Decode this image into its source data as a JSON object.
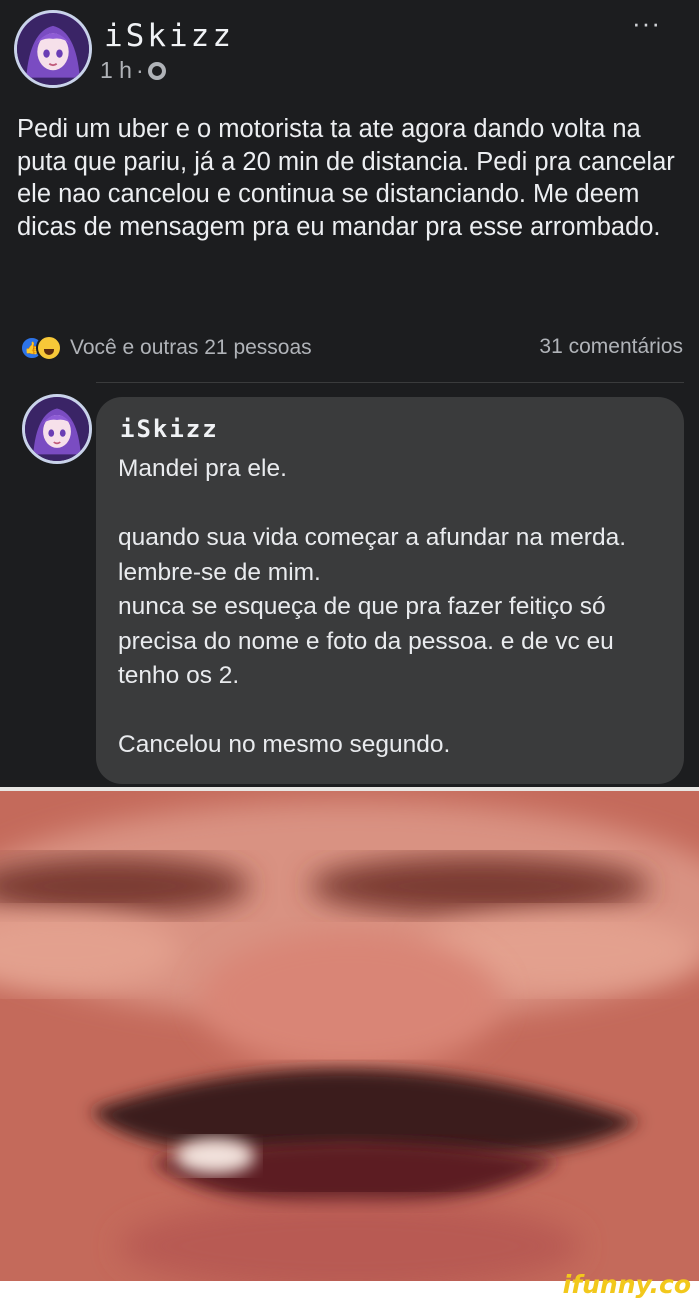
{
  "post": {
    "author": "iSkizz",
    "time": "1 h",
    "separator": "·",
    "more_label": "···",
    "text": "Pedi um uber e o motorista ta ate agora dando volta na puta que pariu, já a 20 min de distancia. Pedi pra cancelar ele nao cancelou e continua se distanciando. Me deem dicas de mensagem pra eu mandar pra esse arrombado.",
    "reactions_text": "Você e outras 21 pessoas",
    "comments_text": "31 comentários",
    "like_icon": "like-icon",
    "haha_icon": "haha-icon"
  },
  "comment": {
    "author": "iSkizz",
    "text": "Mandei pra ele.\n\nquando sua vida começar a afundar na merda. lembre-se de mim.\nnunca se esqueça de que pra fazer feitiço só precisa do nome e foto da pessoa. e de vc eu tenho os 2.\n\nCancelou no mesmo segundo."
  },
  "watermark": "ifunny.co",
  "colors": {
    "background": "#1c1d1f",
    "bubble": "#3a3b3c",
    "like": "#2d73e6",
    "haha": "#f7c838",
    "watermark": "#f2c81c"
  }
}
